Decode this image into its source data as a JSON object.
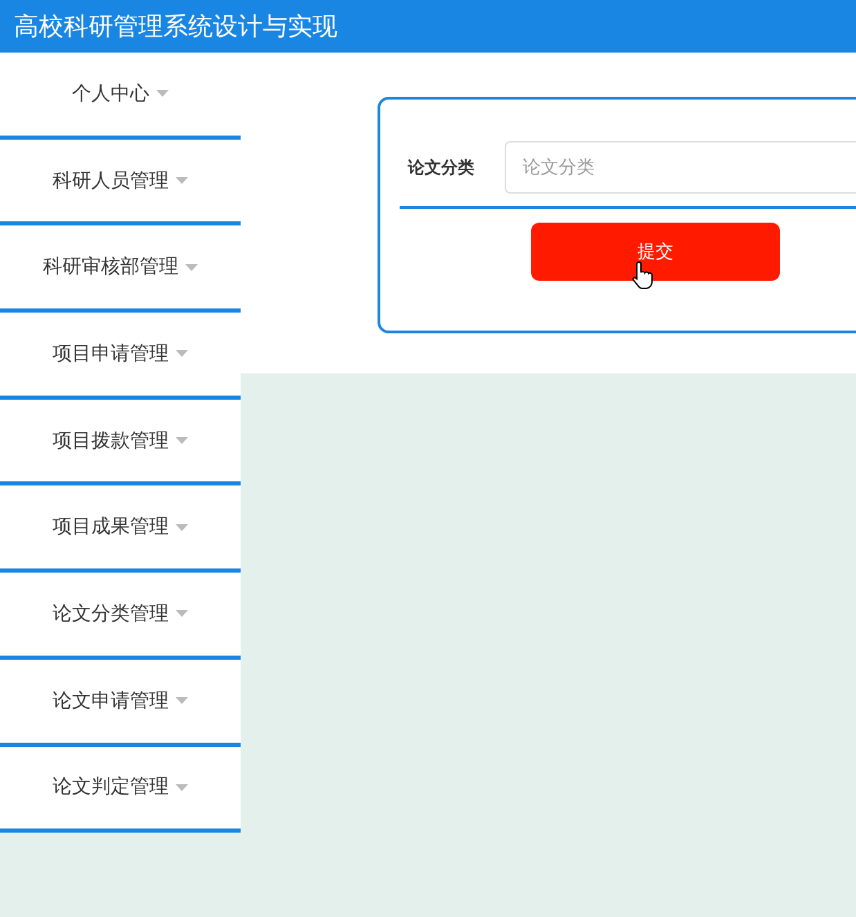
{
  "header": {
    "title": "高校科研管理系统设计与实现"
  },
  "sidebar": {
    "items": [
      {
        "label": "个人中心"
      },
      {
        "label": "科研人员管理"
      },
      {
        "label": "科研审核部管理"
      },
      {
        "label": "项目申请管理"
      },
      {
        "label": "项目拨款管理"
      },
      {
        "label": "项目成果管理"
      },
      {
        "label": "论文分类管理"
      },
      {
        "label": "论文申请管理"
      },
      {
        "label": "论文判定管理"
      }
    ]
  },
  "form": {
    "fields": [
      {
        "label": "论文分类",
        "placeholder": "论文分类"
      }
    ],
    "submit": "提交"
  }
}
